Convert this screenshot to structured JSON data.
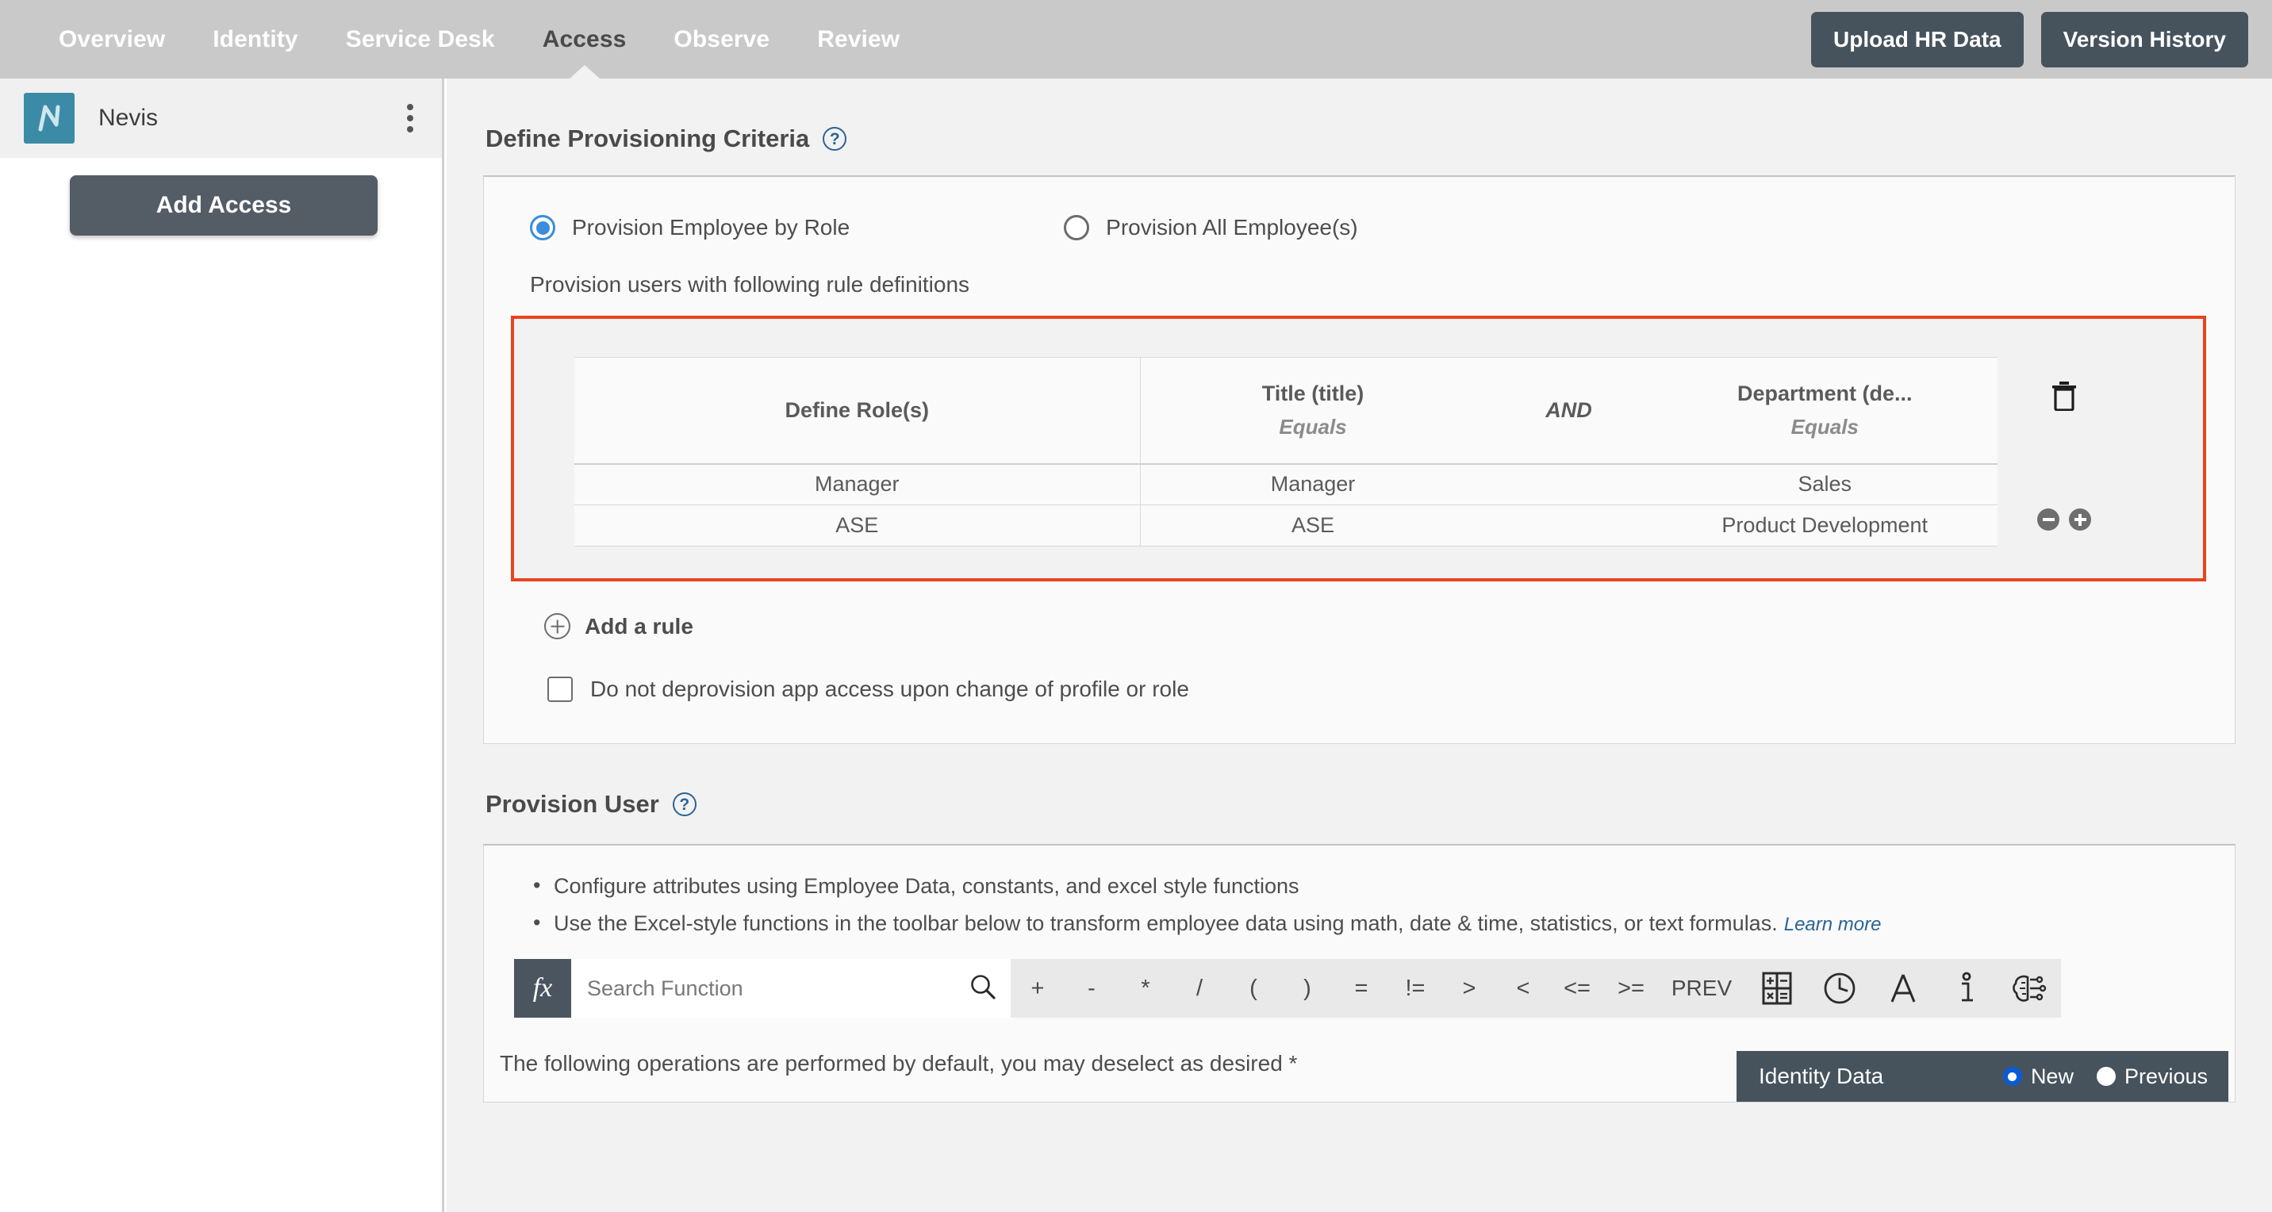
{
  "topnav": {
    "tabs": [
      {
        "label": "Overview",
        "active": false
      },
      {
        "label": "Identity",
        "active": false
      },
      {
        "label": "Service Desk",
        "active": false
      },
      {
        "label": "Access",
        "active": true
      },
      {
        "label": "Observe",
        "active": false
      },
      {
        "label": "Review",
        "active": false
      }
    ],
    "upload_button": "Upload HR Data",
    "version_button": "Version History",
    "bar_color": "#c9c9c9",
    "button_color": "#46535d"
  },
  "sidebar": {
    "app_name": "Nevis",
    "logo_icon": "nevis-logo-icon",
    "logo_color": "#3b8ba6",
    "menu_icon": "kebab-menu-icon",
    "add_access_label": "Add Access"
  },
  "criteria": {
    "title": "Define Provisioning Criteria",
    "help_icon": "help-circle-icon",
    "radios": [
      {
        "label": "Provision Employee by Role",
        "selected": true
      },
      {
        "label": "Provision All Employee(s)",
        "selected": false
      }
    ],
    "caption": "Provision users with following rule definitions",
    "highlight_color": "#e8441f",
    "rule_table": {
      "role_header": "Define Role(s)",
      "conditions": [
        {
          "field": "Title (title)",
          "operator": "Equals"
        },
        {
          "field": "Department (de...",
          "operator": "Equals"
        }
      ],
      "conjunction": "AND",
      "rows": [
        {
          "role": "Manager",
          "title": "Manager",
          "department": "Sales"
        },
        {
          "role": "ASE",
          "title": "ASE",
          "department": "Product Development"
        }
      ],
      "delete_icon": "trash-icon",
      "remove_row_icon": "minus-circle-icon",
      "add_row_icon": "plus-circle-icon"
    },
    "add_rule_label": "Add a rule",
    "add_rule_icon": "plus-circle-icon",
    "deprovision_label": "Do not deprovision app access upon change of profile or role",
    "deprovision_checked": false
  },
  "provision_user": {
    "title": "Provision User",
    "help_icon": "help-circle-icon",
    "bullets": [
      "Configure attributes using Employee Data, constants, and excel style functions",
      "Use the Excel-style functions in the toolbar below to transform employee data using math, date & time, statistics, or text formulas."
    ],
    "learn_more": "Learn more",
    "toolbar": {
      "fx_label": "fx",
      "search_placeholder": "Search Function",
      "search_value": "",
      "search_icon": "search-icon",
      "operators": [
        "+",
        "-",
        "*",
        "/",
        "(",
        ")",
        "=",
        "!=",
        ">",
        "<",
        "<=",
        ">="
      ],
      "prev_label": "PREV",
      "icons": [
        {
          "name": "calculator-icon",
          "tooltip": "math"
        },
        {
          "name": "clock-icon",
          "tooltip": "date & time"
        },
        {
          "name": "text-letter-a-icon",
          "tooltip": "text"
        },
        {
          "name": "info-statistics-icon",
          "tooltip": "statistics"
        },
        {
          "name": "ai-brain-icon",
          "tooltip": "ai"
        }
      ]
    },
    "footer_note": "The following operations are performed by default, you may deselect as desired *",
    "identity_data": {
      "label": "Identity Data",
      "options": [
        {
          "label": "New",
          "selected": true
        },
        {
          "label": "Previous",
          "selected": false
        }
      ],
      "panel_color": "#46535d",
      "accent_color": "#0a5bd4"
    }
  }
}
